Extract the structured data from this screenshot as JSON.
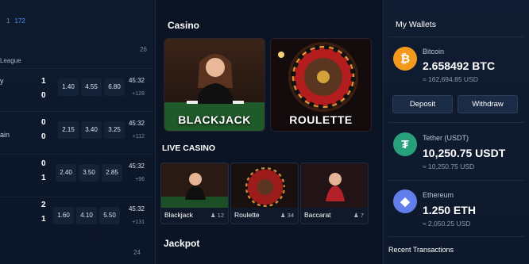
{
  "sports": {
    "header_num": "1",
    "header_hl": "172",
    "count_top": "26",
    "league_label": "League",
    "matches": [
      {
        "team": "y",
        "score_home": "1",
        "score_away": "0",
        "odds": [
          "1.40",
          "4.55",
          "6.80"
        ],
        "time": "45:32",
        "more": "+128"
      },
      {
        "team": "ain",
        "score_home": "0",
        "score_away": "0",
        "odds": [
          "2.15",
          "3.40",
          "3.25"
        ],
        "time": "45:32",
        "more": "+112"
      },
      {
        "team": "",
        "score_home": "0",
        "score_away": "1",
        "odds": [
          "2.40",
          "3.50",
          "2.85"
        ],
        "time": "45:32",
        "more": "+96"
      },
      {
        "team": "",
        "score_home": "2",
        "score_away": "1",
        "odds": [
          "1.60",
          "4.10",
          "5.50"
        ],
        "time": "45:32",
        "more": "+131"
      }
    ],
    "count_bottom": "24"
  },
  "casino": {
    "title": "Casino",
    "featured": [
      {
        "label": "BLACKJACK"
      },
      {
        "label": "ROULETTE"
      }
    ],
    "live_title": "LIVE CASINO",
    "live": [
      {
        "name": "Blackjack",
        "users": "♟ 12"
      },
      {
        "name": "Roulette",
        "users": "♟ 34"
      },
      {
        "name": "Baccarat",
        "users": "♟ 7"
      }
    ],
    "jackpot_title": "Jackpot"
  },
  "wallets": {
    "title": "My Wallets",
    "items": [
      {
        "name": "Bitcoin",
        "amount": "2.658492 BTC",
        "usd": "≈ 162,694.85 USD",
        "symbol": "₿",
        "color": "#f39a1e"
      },
      {
        "name": "Tether (USDT)",
        "amount": "10,250.75 USDT",
        "usd": "≈ 10,250.75 USD",
        "symbol": "₮",
        "color": "#26a17b"
      },
      {
        "name": "Ethereum",
        "amount": "1.250 ETH",
        "usd": "≈ 2,050.25 USD",
        "symbol": "◆",
        "color": "#627eea"
      }
    ],
    "deposit_label": "Deposit",
    "withdraw_label": "Withdraw",
    "recent_label": "Recent Transactions"
  }
}
